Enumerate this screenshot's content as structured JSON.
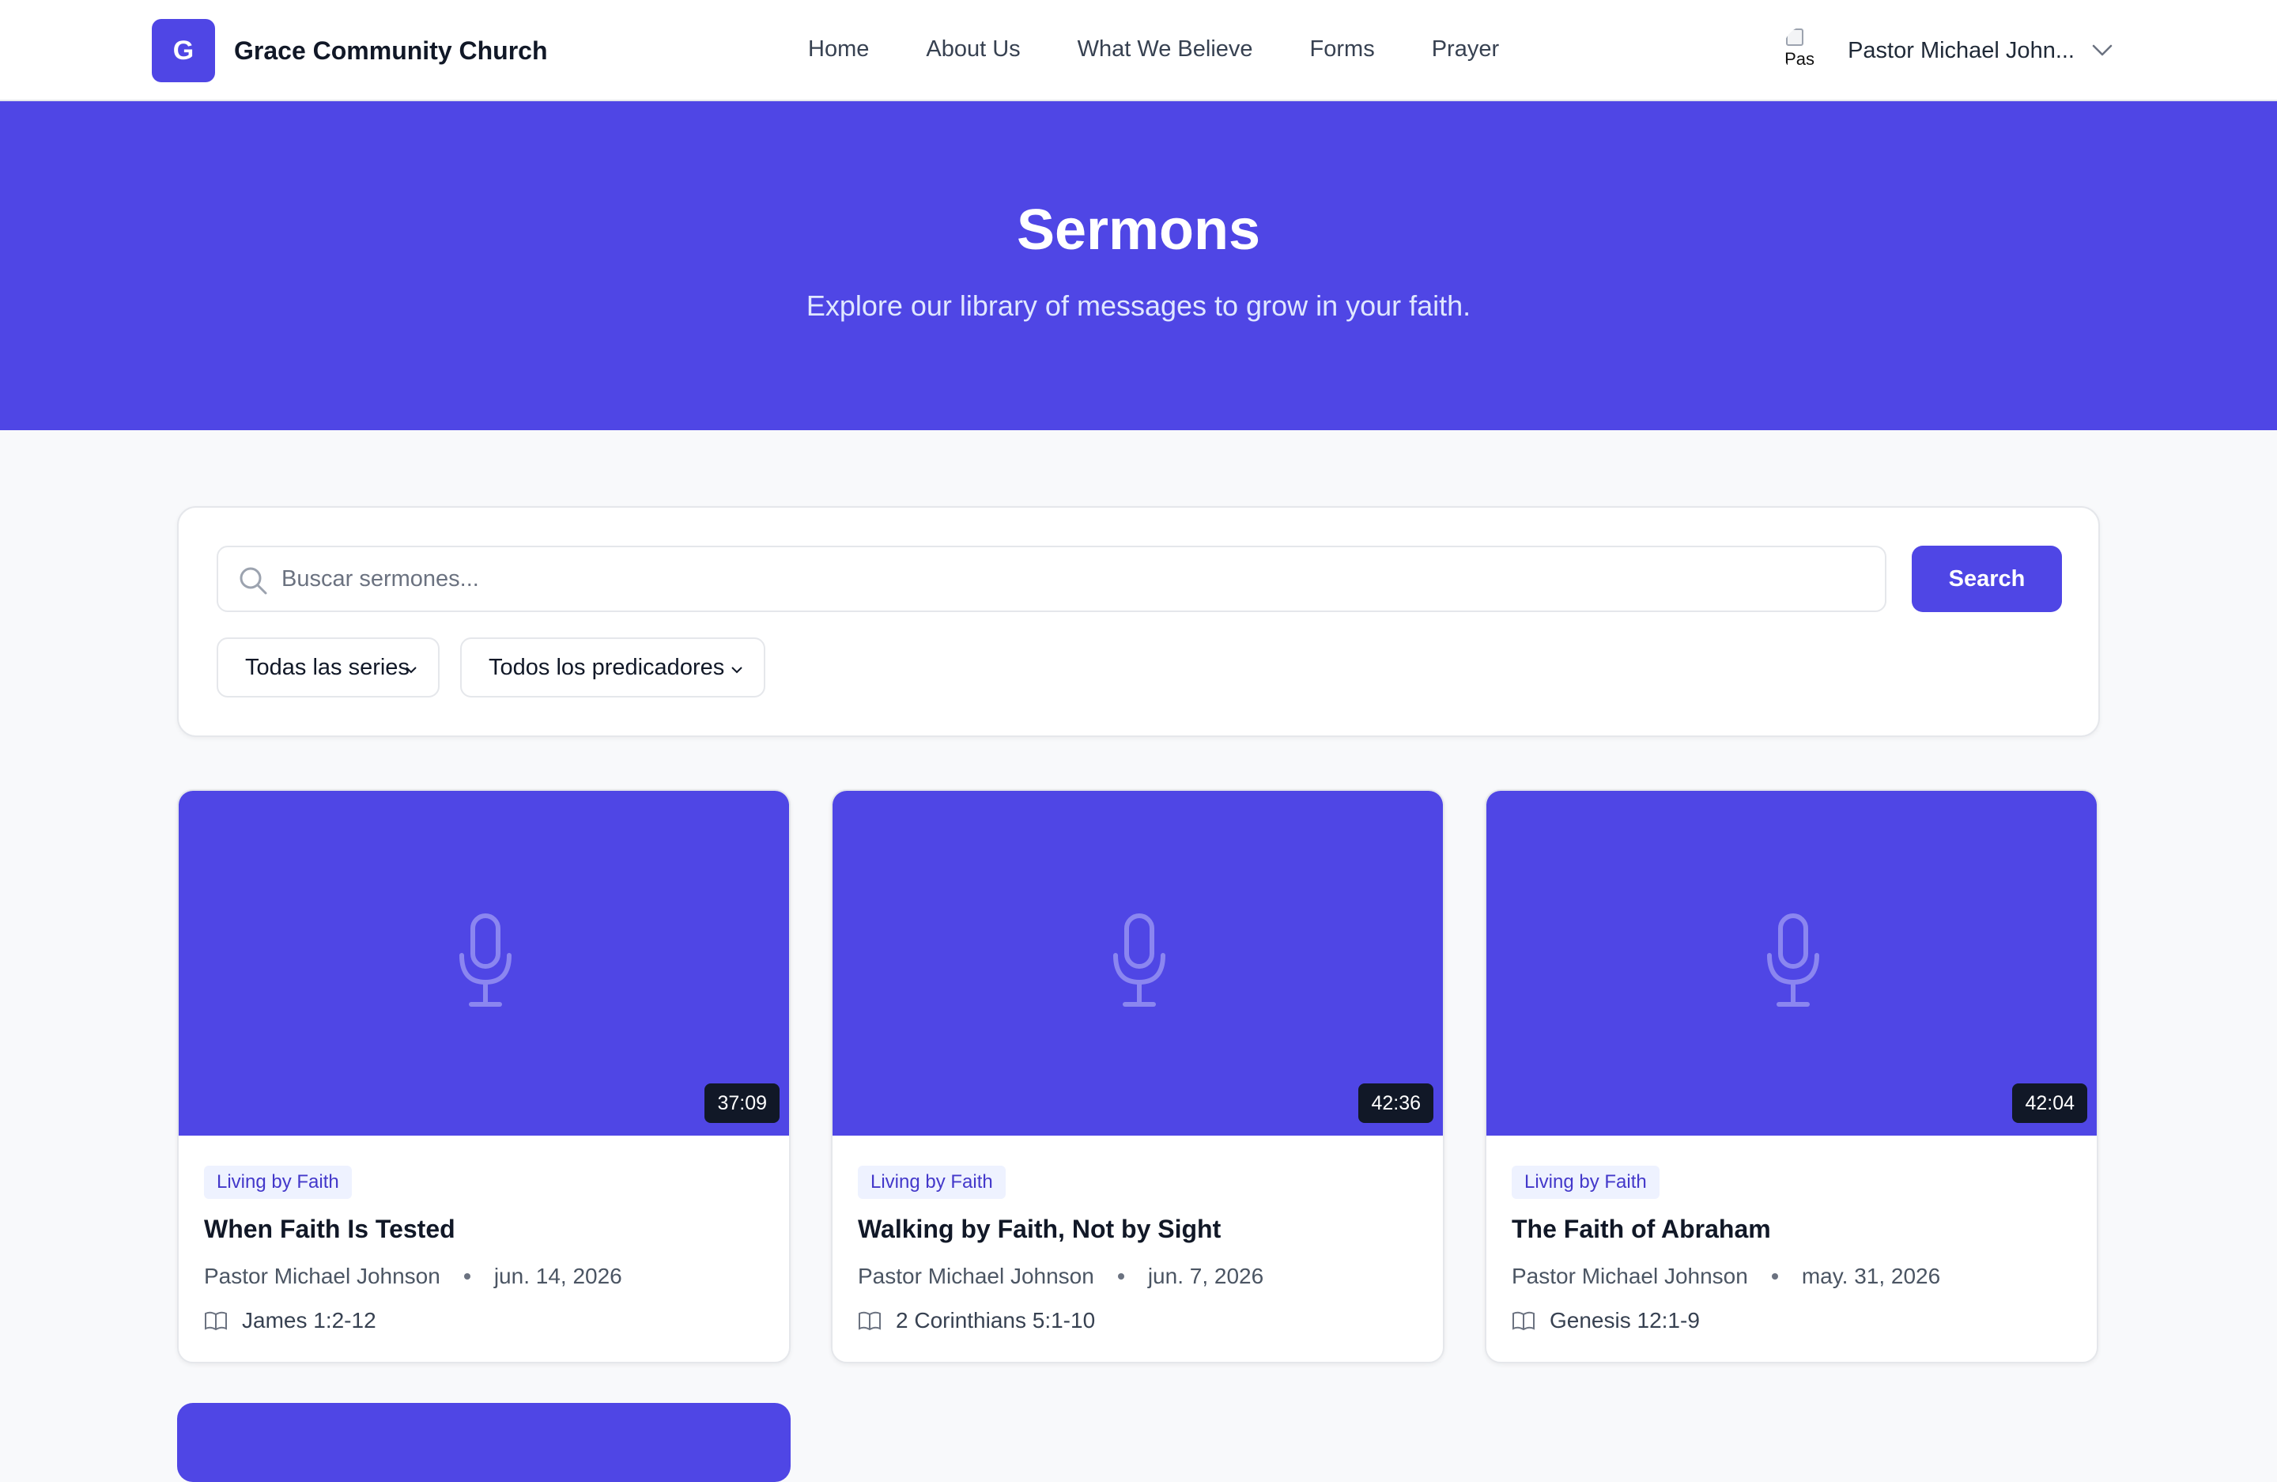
{
  "header": {
    "logo_letter": "G",
    "brand": "Grace Community Church",
    "nav": [
      "Home",
      "About Us",
      "What We Believe",
      "Forms",
      "Prayer"
    ],
    "user_name": "Pastor Michael John...",
    "avatar_alt": "Pas",
    "user_menu_icon": "chevron-down-icon"
  },
  "hero": {
    "title": "Sermons",
    "subtitle": "Explore our library of messages to grow in your faith."
  },
  "search": {
    "placeholder": "Buscar sermones...",
    "value": "",
    "button": "Search",
    "filters": [
      "Todas las series",
      "Todos los predicadores"
    ]
  },
  "sermons": [
    {
      "series": "Living by Faith",
      "title": "When Faith Is Tested",
      "preacher": "Pastor Michael Johnson",
      "date": "jun. 14, 2026",
      "scripture": "James 1:2-12",
      "duration": "37:09"
    },
    {
      "series": "Living by Faith",
      "title": "Walking by Faith, Not by Sight",
      "preacher": "Pastor Michael Johnson",
      "date": "jun. 7, 2026",
      "scripture": "2 Corinthians 5:1-10",
      "duration": "42:36"
    },
    {
      "series": "Living by Faith",
      "title": "The Faith of Abraham",
      "preacher": "Pastor Michael Johnson",
      "date": "may. 31, 2026",
      "scripture": "Genesis 12:1-9",
      "duration": "42:04"
    }
  ],
  "colors": {
    "primary": "#4f46e5",
    "tag_bg": "#eef2ff",
    "tag_text": "#4338ca"
  }
}
